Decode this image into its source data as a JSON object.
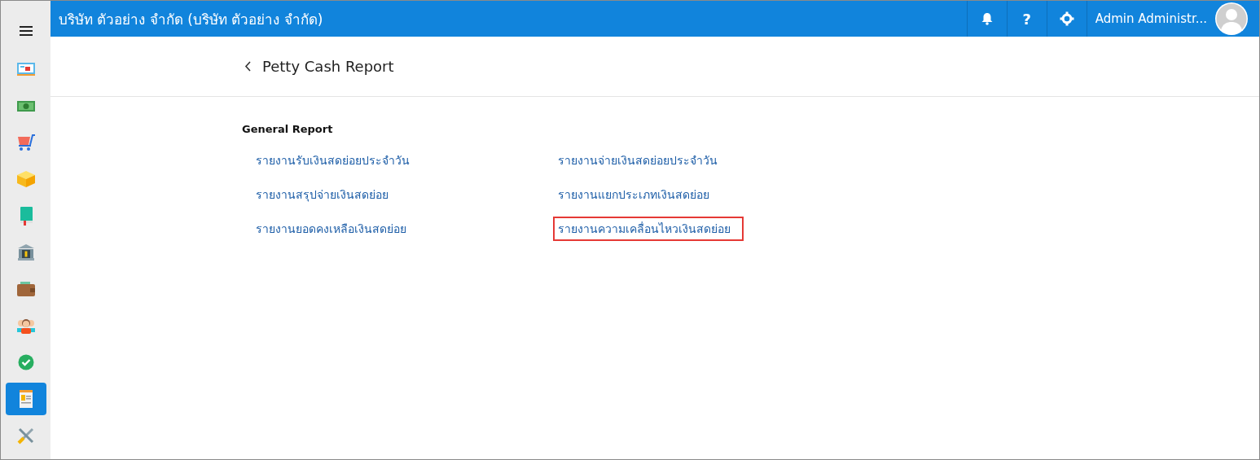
{
  "topbar": {
    "company": "บริษัท ตัวอย่าง จำกัด (บริษัท ตัวอย่าง จำกัด)",
    "help": "?",
    "user": "Admin Administr..."
  },
  "sidebar": {
    "items": [
      {
        "kind": "monitor",
        "selected": false
      },
      {
        "kind": "money",
        "selected": false
      },
      {
        "kind": "cart",
        "selected": false
      },
      {
        "kind": "box",
        "selected": false
      },
      {
        "kind": "book",
        "selected": false
      },
      {
        "kind": "bank",
        "selected": false
      },
      {
        "kind": "wallet",
        "selected": false
      },
      {
        "kind": "people",
        "selected": false
      },
      {
        "kind": "check",
        "selected": false
      },
      {
        "kind": "report",
        "selected": true
      },
      {
        "kind": "tools",
        "selected": false
      }
    ]
  },
  "page": {
    "title": "Petty Cash Report"
  },
  "section": {
    "heading": "General Report",
    "reports": [
      {
        "label": "รายงานรับเงินสดย่อยประจำวัน",
        "highlighted": false
      },
      {
        "label": "รายงานจ่ายเงินสดย่อยประจำวัน",
        "highlighted": false
      },
      {
        "label": "รายงานสรุปจ่ายเงินสดย่อย",
        "highlighted": false
      },
      {
        "label": "รายงานแยกประเภทเงินสดย่อย",
        "highlighted": false
      },
      {
        "label": "รายงานยอดคงเหลือเงินสดย่อย",
        "highlighted": false
      },
      {
        "label": "รายงานความเคลื่อนไหวเงินสดย่อย",
        "highlighted": true
      }
    ]
  }
}
